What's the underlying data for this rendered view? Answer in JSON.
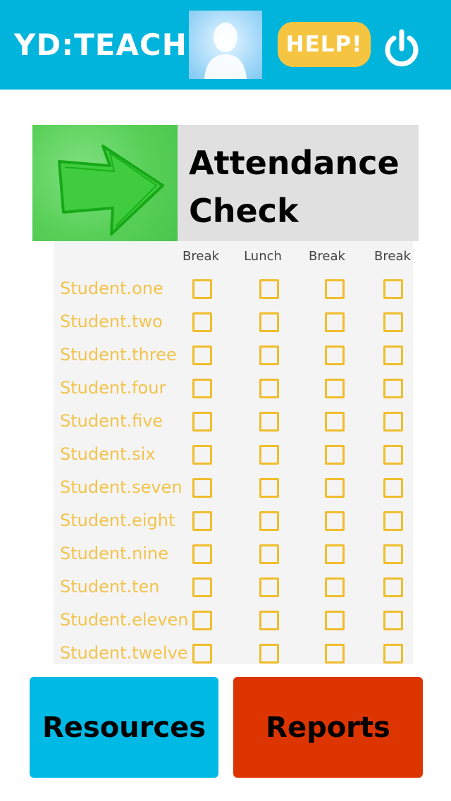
{
  "header": {
    "logo": "YD:TEACH",
    "help_label": "HELP!",
    "power_icon": "power-icon",
    "avatar_icon": "user-silhouette-icon"
  },
  "title_card": {
    "line1": "Attendance",
    "line2": "Check",
    "icon": "green-arrow-icon"
  },
  "columns": [
    "Break",
    "Lunch",
    "Break",
    "Break"
  ],
  "students": [
    "Student.one",
    "Student.two",
    "Student.three",
    "Student.four",
    "Student.five",
    "Student.six",
    "Student.seven",
    "Student.eight",
    "Student.nine",
    "Student.ten",
    "Student.eleven",
    "Student.twelve"
  ],
  "buttons": {
    "resources": "Resources",
    "reports": "Reports"
  },
  "colors": {
    "header_bg": "#00b4dc",
    "help_bg": "#f5c542",
    "student_text": "#f3c34b",
    "checkbox_border": "#f0bd2d",
    "resources_bg": "#00b9e4",
    "reports_bg": "#dd3500"
  }
}
